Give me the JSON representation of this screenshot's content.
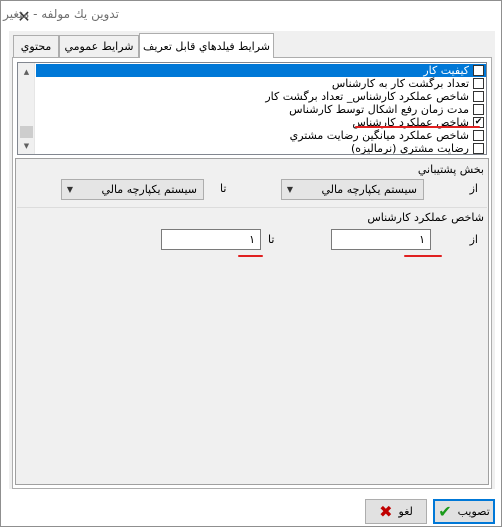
{
  "window": {
    "title": "تدوين يك مولفه - متغير",
    "close_glyph": "✕"
  },
  "tabs": [
    {
      "label": "شرايط فيلدهاي قابل تعريف",
      "active": true
    },
    {
      "label": "شرايط عمومي",
      "active": false
    },
    {
      "label": "محتوي",
      "active": false
    }
  ],
  "checklist": {
    "items": [
      {
        "label": "كيفيت كار",
        "checked": false,
        "selected": true
      },
      {
        "label": "تعداد برگشت كار به كارشناس",
        "checked": false,
        "selected": false
      },
      {
        "label": "شاخص عملكرد كارشناس_ تعداد برگشت كار",
        "checked": false,
        "selected": false
      },
      {
        "label": "مدت زمان رفع اشكال توسط كارشناس",
        "checked": false,
        "selected": false
      },
      {
        "label": "شاخص عملكرد كارشناس",
        "checked": true,
        "selected": false
      },
      {
        "label": "شاخص عملكرد ميانگين رضايت مشتري",
        "checked": false,
        "selected": false
      },
      {
        "label": "رضايت مشتري (نرماليزه)",
        "checked": false,
        "selected": false
      }
    ],
    "scroll_up_glyph": "▲",
    "scroll_down_glyph": "▼"
  },
  "support_section": {
    "label": "بخش پشتيباني",
    "from_label": "از",
    "to_label": "تا",
    "from_value": "سيستم يكپارچه مالي",
    "to_value": "سيستم يكپارچه مالي",
    "arrow_glyph": "▼"
  },
  "kpi_section": {
    "label": "شاخص عملكرد كارشناس",
    "from_label": "از",
    "to_label": "تا",
    "from_value": "١",
    "to_value": "١"
  },
  "buttons": {
    "ok_label": "تصويب",
    "ok_glyph": "✔",
    "cancel_label": "لغو",
    "cancel_glyph": "✖"
  },
  "colors": {
    "selection": "#0078d7",
    "annotation_red": "#e02020",
    "ok_green": "#1a9a1a",
    "cancel_red": "#c00000"
  }
}
